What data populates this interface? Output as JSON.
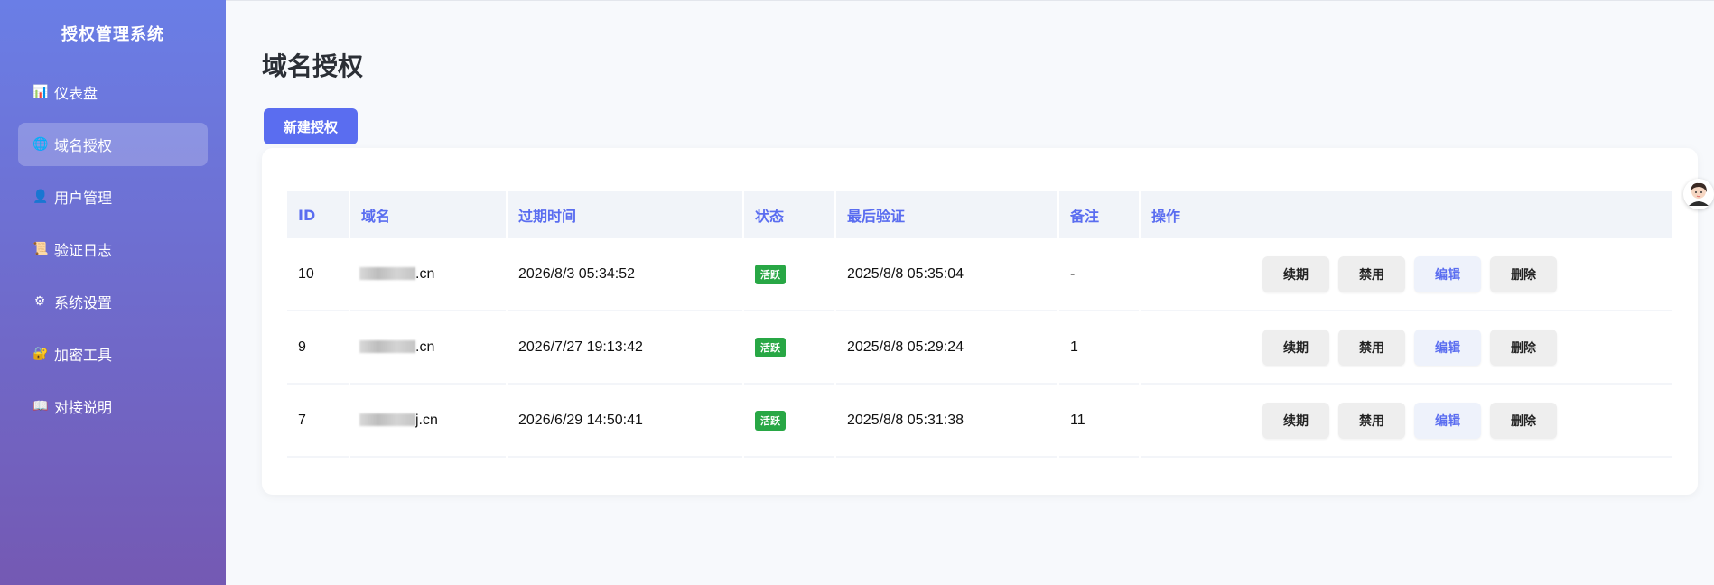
{
  "sidebar": {
    "title": "授权管理系统",
    "items": [
      {
        "icon": "📊",
        "label": "仪表盘",
        "active": false
      },
      {
        "icon": "🌐",
        "label": "域名授权",
        "active": true
      },
      {
        "icon": "👤",
        "label": "用户管理",
        "active": false
      },
      {
        "icon": "📜",
        "label": "验证日志",
        "active": false
      },
      {
        "icon": "⚙",
        "label": "系统设置",
        "active": false
      },
      {
        "icon": "🔐",
        "label": "加密工具",
        "active": false
      },
      {
        "icon": "📖",
        "label": "对接说明",
        "active": false
      }
    ]
  },
  "page": {
    "title": "域名授权",
    "new_button": "新建授权"
  },
  "table": {
    "headers": [
      "ID",
      "域名",
      "过期时间",
      "状态",
      "最后验证",
      "备注",
      "操作"
    ],
    "rows": [
      {
        "id": "10",
        "domain_suffix": ".cn",
        "expire": "2026/8/3 05:34:52",
        "status": "活跃",
        "last_verify": "2025/8/8 05:35:04",
        "note": "-"
      },
      {
        "id": "9",
        "domain_suffix": ".cn",
        "expire": "2026/7/27 19:13:42",
        "status": "活跃",
        "last_verify": "2025/8/8 05:29:24",
        "note": "1"
      },
      {
        "id": "7",
        "domain_suffix": "j.cn",
        "expire": "2026/6/29 14:50:41",
        "status": "活跃",
        "last_verify": "2025/8/8 05:31:38",
        "note": "11"
      }
    ],
    "actions": {
      "renew": "续期",
      "disable": "禁用",
      "edit": "编辑",
      "delete": "删除"
    }
  },
  "colors": {
    "accent": "#5a6df0",
    "status_active": "#28a745",
    "sidebar_top": "#6a7ee6",
    "sidebar_bottom": "#7459b3"
  }
}
